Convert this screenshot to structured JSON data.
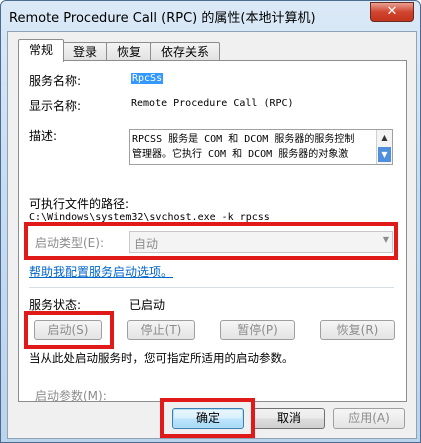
{
  "window": {
    "title": "Remote Procedure Call (RPC) 的属性(本地计算机)",
    "close_label": "✕"
  },
  "tabs": [
    {
      "label": "常规",
      "active": true
    },
    {
      "label": "登录",
      "active": false
    },
    {
      "label": "恢复",
      "active": false
    },
    {
      "label": "依存关系",
      "active": false
    }
  ],
  "general": {
    "service_name_label": "服务名称:",
    "service_name_value": "RpcSs",
    "display_name_label": "显示名称:",
    "display_name_value": "Remote Procedure Call (RPC)",
    "description_label": "描述:",
    "description_lines": [
      "RPCSS 服务是 COM 和 DCOM 服务器的服务控制",
      "管理器。它执行 COM 和 DCOM 服务器的对象激"
    ],
    "exe_path_label": "可执行文件的路径:",
    "exe_path_value": "C:\\Windows\\system32\\svchost.exe -k rpcss",
    "startup_type_label": "启动类型(E):",
    "startup_type_value": "自动",
    "help_link": "帮助我配置服务启动选项。",
    "service_status_label": "服务状态:",
    "service_status_value": "已启动",
    "buttons": {
      "start": "启动(S)",
      "stop": "停止(T)",
      "pause": "暂停(P)",
      "resume": "恢复(R)"
    },
    "hint_text": "当从此处启动服务时，您可指定所适用的启动参数。",
    "start_params_label": "启动参数(M):"
  },
  "footer": {
    "ok": "确定",
    "cancel": "取消",
    "apply": "应用(A)"
  },
  "colors": {
    "highlight_box": "#e01919",
    "link": "#0066cc",
    "selection": "#3399ff"
  },
  "icons": {
    "scroll_up": "▲",
    "scroll_down": "▼",
    "combo_arrow": "▼"
  }
}
